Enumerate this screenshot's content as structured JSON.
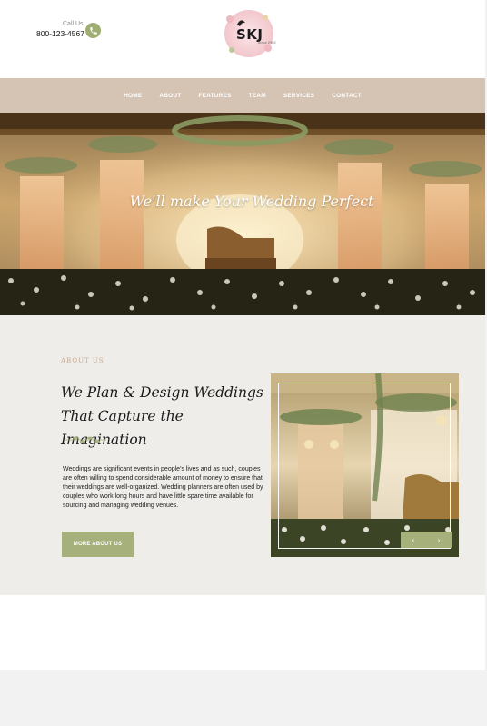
{
  "header": {
    "call_label": "Call Us",
    "phone": "800-123-4567",
    "phone_icon": "phone-icon",
    "logo_text": "SKJ",
    "logo_sub": "Since 1982"
  },
  "nav": {
    "items": [
      "HOME",
      "ABOUT",
      "FEATURES",
      "TEAM",
      "SERVICES",
      "CONTACT"
    ]
  },
  "hero": {
    "title": "We'll make Your Wedding Perfect"
  },
  "about": {
    "kicker": "ABOUT US",
    "title_line1": "We Plan & Design Weddings",
    "title_line2": "That Capture the Imagination",
    "body": "Weddings are significant events in people's lives and as such, couples are often willing to spend considerable amount of money to ensure that their weddings are well-organized. Wedding planners are often used by couples who work long hours and have little spare time available for sourcing and managing wedding venues.",
    "button": "MORE ABOUT US",
    "prev_icon": "chevron-left-icon",
    "next_icon": "chevron-right-icon",
    "prev_glyph": "‹",
    "next_glyph": "›"
  },
  "colors": {
    "accent": "#a5b07a",
    "nav_bg": "#d5c3b3",
    "kicker": "#c9a98f",
    "section_bg": "#efedea"
  }
}
